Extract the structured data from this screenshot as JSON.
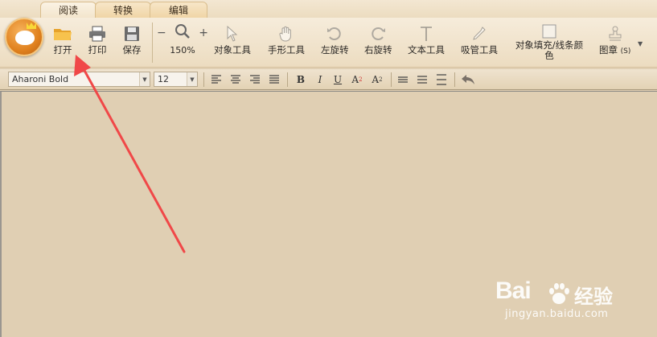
{
  "tabs": [
    {
      "label": "阅读"
    },
    {
      "label": "转换"
    },
    {
      "label": "编辑"
    }
  ],
  "ribbon": {
    "open": "打开",
    "print": "打印",
    "save": "保存",
    "zoom_minus": "−",
    "zoom_plus": "+",
    "zoom_value": "150%",
    "object_tool": "对象工具",
    "hand_tool": "手形工具",
    "rotate_left": "左旋转",
    "rotate_right": "右旋转",
    "text_tool": "文本工具",
    "eyedropper_tool": "吸管工具",
    "fill_line_color_1": "对象填充/线条颜",
    "fill_line_color_2": "色",
    "stamp": "图章",
    "stamp_key": "(S)"
  },
  "format": {
    "font_name": "Aharoni Bold",
    "font_size": "12",
    "bold": "B",
    "italic": "I",
    "underline": "U",
    "superscript_base": "A",
    "superscript_mark": "2",
    "subscript_base": "A",
    "subscript_mark": "2"
  },
  "watermark": {
    "brand": "Bai",
    "brand_cn": "经验",
    "url": "jingyan.baidu.com"
  },
  "colors": {
    "canvas": "#e0cfb3",
    "annotation_arrow": "#f04848",
    "folder_icon": "#f2b43a"
  }
}
